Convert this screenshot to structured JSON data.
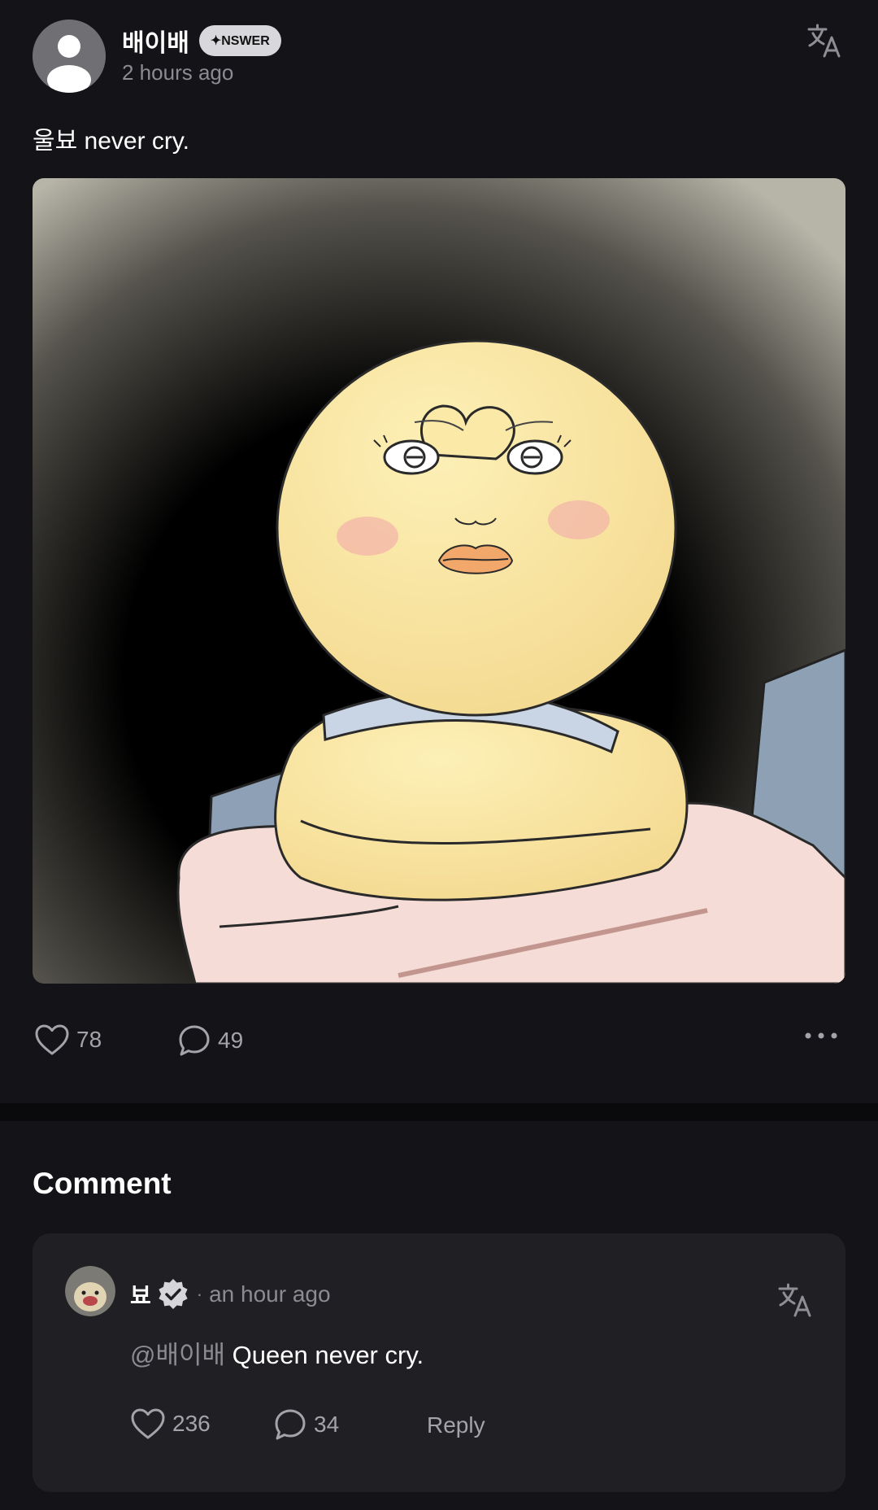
{
  "post": {
    "author": "배이배",
    "badge": "✦NSWER",
    "time": "2 hours ago",
    "text": "울뵤 never cry.",
    "likes": "78",
    "comments": "49"
  },
  "comments_section": {
    "title": "Comment",
    "items": [
      {
        "author": "뵤",
        "separator": "·",
        "time": "an hour ago",
        "mention": "@배이배",
        "text": " Queen never cry.",
        "likes": "236",
        "replies": "34",
        "reply_label": "Reply"
      }
    ]
  },
  "icons": {
    "translate": "translate-icon",
    "like": "heart-icon",
    "comment": "comment-bubble-icon",
    "more": "more-dots-icon",
    "verified": "verified-badge-icon"
  }
}
